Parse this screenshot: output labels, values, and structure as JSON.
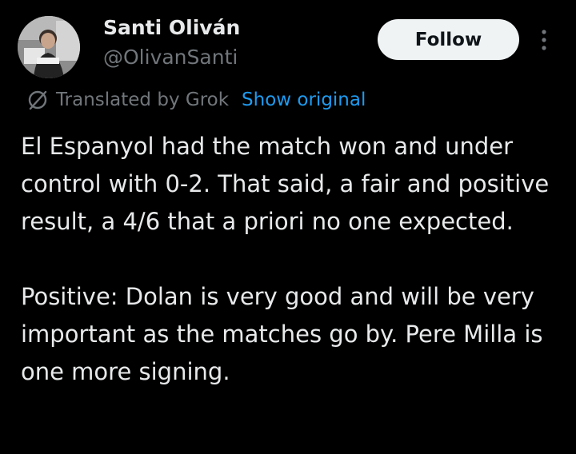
{
  "author": {
    "display_name": "Santi Oliván",
    "handle": "@OlivanSanti"
  },
  "actions": {
    "follow_label": "Follow",
    "more_icon": "more-vertical-icon"
  },
  "translation": {
    "icon": "translate-icon",
    "label": "Translated by Grok",
    "show_original": "Show original"
  },
  "tweet": {
    "paragraphs": [
      "El Espanyol had the match won and under control with 0-2. That said, a fair and positive result, a 4/6 that a priori no one expected.",
      "Positive: Dolan is very good and will be very important as the matches go by. Pere Milla is one more signing."
    ]
  },
  "colors": {
    "background": "#000000",
    "text_primary": "#e7e9ea",
    "text_secondary": "#71767b",
    "link": "#1d9bf0",
    "button_bg": "#eff3f4",
    "button_text": "#0f1419"
  }
}
